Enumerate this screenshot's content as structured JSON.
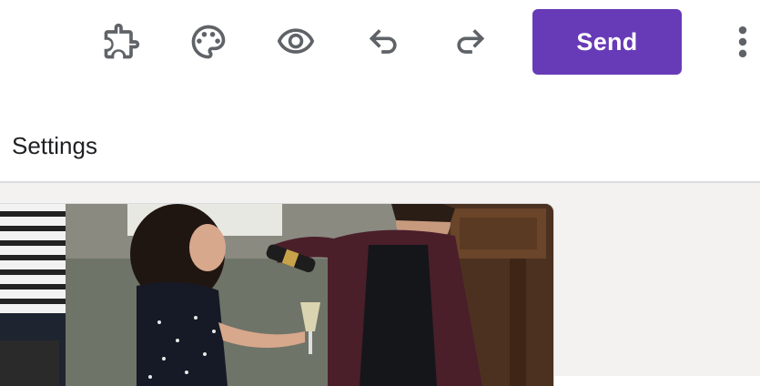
{
  "toolbar": {
    "icons": [
      "add-ons-icon",
      "customize-theme-icon",
      "preview-icon",
      "undo-icon",
      "redo-icon"
    ],
    "send_label": "Send",
    "more_icon": "more-vert-icon"
  },
  "tabs": {
    "settings_label": "Settings"
  },
  "header_image": {
    "subject": "photo"
  },
  "colors": {
    "accent": "#673ab7",
    "icon": "#5f6368",
    "canvas_bg": "#f4f2f0"
  }
}
